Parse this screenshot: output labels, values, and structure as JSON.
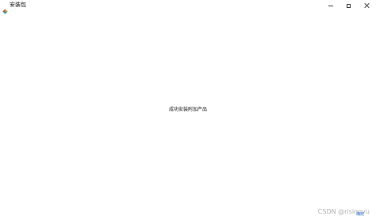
{
  "window": {
    "title": "安装包",
    "icon": "colorful-app-icon"
  },
  "controls": {
    "minimize_icon": "minimize-icon",
    "maximize_icon": "maximize-icon",
    "close_icon": "close-icon"
  },
  "main": {
    "message": "成功安装附加产品",
    "ok_label": "确定"
  },
  "watermark": {
    "text": "CSDN @risingyu"
  },
  "colors": {
    "link": "#2a6fd6",
    "background": "#ffffff"
  }
}
